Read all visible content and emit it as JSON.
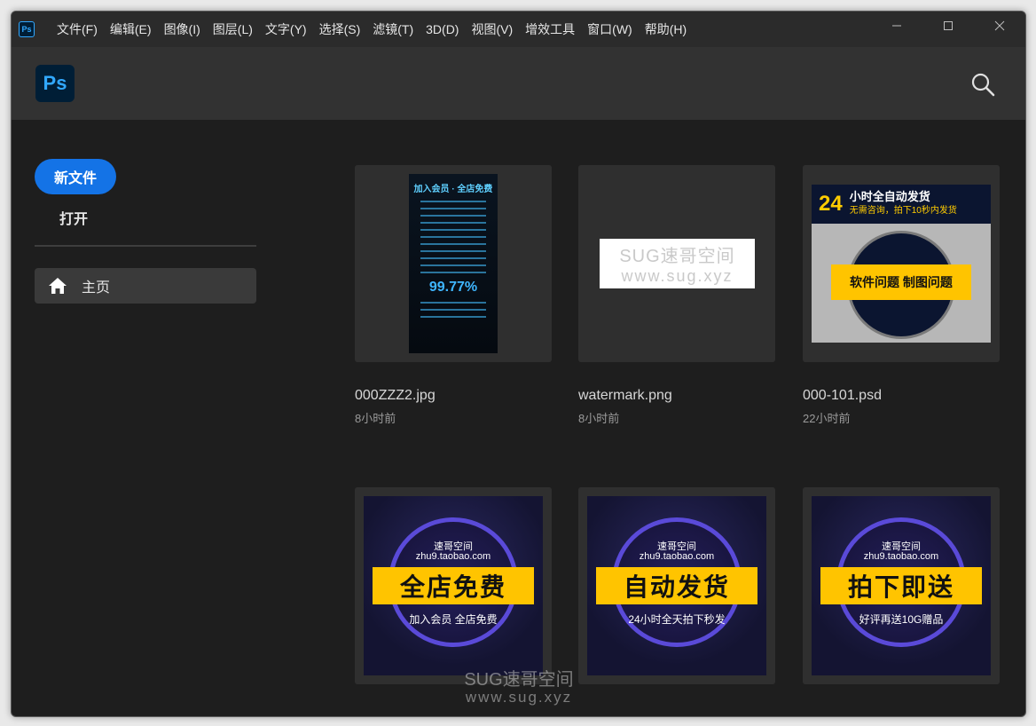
{
  "menubar": {
    "app_icon": "Ps",
    "items": [
      "文件(F)",
      "编辑(E)",
      "图像(I)",
      "图层(L)",
      "文字(Y)",
      "选择(S)",
      "滤镜(T)",
      "3D(D)",
      "视图(V)",
      "增效工具",
      "窗口(W)",
      "帮助(H)"
    ]
  },
  "window_controls": [
    "minimize-icon",
    "maximize-icon",
    "close-icon"
  ],
  "header": {
    "logo": "Ps",
    "search_icon": "search-icon"
  },
  "sidebar": {
    "new_file": "新文件",
    "open": "打开",
    "home": "主页",
    "home_icon": "home-icon"
  },
  "files": [
    {
      "name": "000ZZZ2.jpg",
      "time": "8小时前",
      "thumb": {
        "title": "加入会员 · 全店免费",
        "percent": "99.77%"
      }
    },
    {
      "name": "watermark.png",
      "time": "8小时前",
      "thumb": {
        "line1": "SUG速哥空间",
        "line2": "www.sug.xyz"
      }
    },
    {
      "name": "000-101.psd",
      "time": "22小时前",
      "thumb": {
        "big": "24",
        "head1": "小时全自动发货",
        "head2": "无需咨询，拍下10秒内发货",
        "bar": "软件问题  制图问题"
      }
    },
    {
      "name": "",
      "time": "",
      "thumb": {
        "small1": "速哥空间",
        "small2": "zhu9.taobao.com",
        "bar": "全店免费",
        "sub": "加入会员  全店免费"
      }
    },
    {
      "name": "",
      "time": "",
      "thumb": {
        "small1": "速哥空间",
        "small2": "zhu9.taobao.com",
        "bar": "自动发货",
        "sub": "24小时全天拍下秒发"
      }
    },
    {
      "name": "",
      "time": "",
      "thumb": {
        "small1": "速哥空间",
        "small2": "zhu9.taobao.com",
        "bar": "拍下即送",
        "sub": "好评再送10G赠品"
      }
    }
  ],
  "overlay_watermark": {
    "line1": "SUG速哥空间",
    "line2": "www.sug.xyz"
  },
  "colors": {
    "accent": "#1473e6",
    "ps_blue": "#31a8ff",
    "background": "#1e1e1e",
    "header": "#323232"
  }
}
